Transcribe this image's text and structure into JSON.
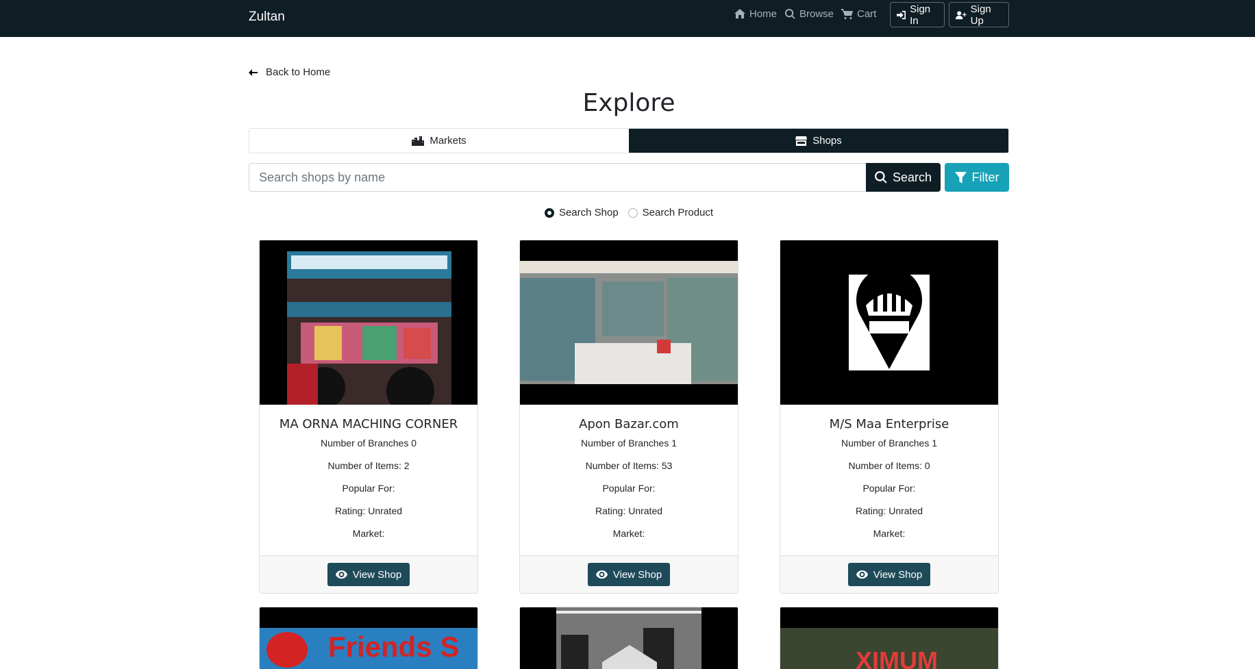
{
  "navbar": {
    "brand": "Zultan",
    "links": [
      {
        "label": "Home",
        "icon": "home-icon"
      },
      {
        "label": "Browse",
        "icon": "search-icon"
      },
      {
        "label": "Cart",
        "icon": "cart-icon"
      }
    ],
    "sign_in": "Sign In",
    "sign_up": "Sign Up"
  },
  "back_label": "Back to Home",
  "page_title": "Explore",
  "tabs": [
    {
      "label": "Markets",
      "active": false
    },
    {
      "label": "Shops",
      "active": true
    }
  ],
  "search": {
    "placeholder": "Search shops by name",
    "button": "Search",
    "filter": "Filter"
  },
  "radios": [
    {
      "label": "Search Shop",
      "checked": true
    },
    {
      "label": "Search Product",
      "checked": false
    }
  ],
  "shops": [
    {
      "name": "MA ORNA MACHING CORNER",
      "branches": "Number of Branches 0",
      "items": "Number of Items: 2",
      "popular": "Popular For:",
      "rating": "Rating: Unrated",
      "market": "Market:",
      "view": "View Shop"
    },
    {
      "name": "Apon Bazar.com",
      "branches": "Number of Branches 1",
      "items": "Number of Items: 53",
      "popular": "Popular For:",
      "rating": "Rating: Unrated",
      "market": "Market:",
      "view": "View Shop"
    },
    {
      "name": "M/S Maa Enterprise",
      "branches": "Number of Branches 1",
      "items": "Number of Items: 0",
      "popular": "Popular For:",
      "rating": "Rating: Unrated",
      "market": "Market:",
      "view": "View Shop"
    }
  ],
  "second_row": [
    {
      "photo_text": "Friends S"
    },
    {
      "photo_text": ""
    },
    {
      "photo_text": "XIMUM"
    }
  ],
  "colors": {
    "navbar": "#0f1e24",
    "filter": "#17a2b8",
    "view_button": "#1e4a59"
  }
}
